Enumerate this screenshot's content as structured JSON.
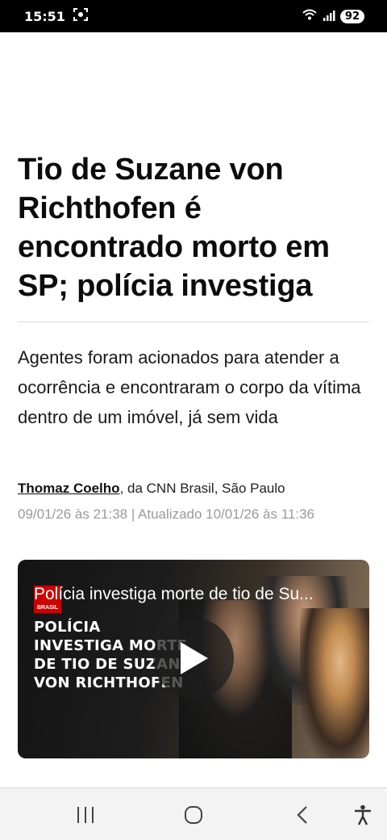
{
  "status_bar": {
    "time": "15:51",
    "battery": "92",
    "icons": [
      "screen-record-icon",
      "wifi-icon",
      "signal-icon",
      "battery-icon"
    ]
  },
  "article": {
    "headline": "Tio de Suzane von Richthofen é encontrado morto em SP; polícia investiga",
    "subtitle": "Agentes foram acionados para atender a ocorrência e encontraram o corpo da vítima dentro de um imóvel, já sem vida",
    "author": "Thomaz Coelho",
    "byline_rest": ", da CNN Brasil, São Paulo",
    "dates": "09/01/26 às 21:38 | Atualizado 10/01/26 às 11:36"
  },
  "video": {
    "title": "Polícia investiga morte de tio de Su...",
    "logo_text": "BRASIL",
    "caption": "POLÍCIA INVESTIGA MORTE DE TIO DE SUZANE VON RICHTHOFEN"
  },
  "nav": {
    "icons": [
      "recent-apps-icon",
      "home-icon",
      "back-icon",
      "accessibility-icon"
    ]
  },
  "colors": {
    "status_bar": "#000000",
    "text": "#0c0c0c",
    "muted": "#9a9a9a",
    "cnn_red": "#cc0000",
    "nav_bar": "#f3f3f3"
  }
}
